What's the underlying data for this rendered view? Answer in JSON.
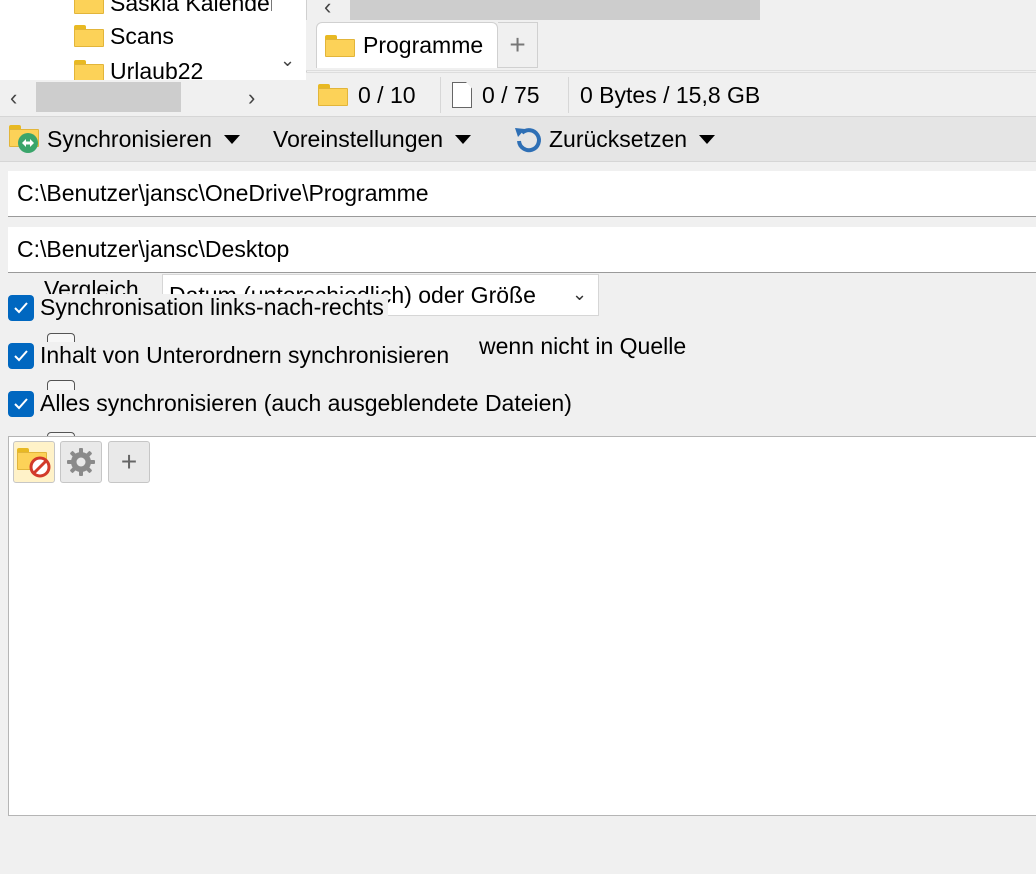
{
  "tree": {
    "items": [
      {
        "label": "Saskia Kalender"
      },
      {
        "label": "Scans"
      },
      {
        "label": "Urlaub22"
      }
    ]
  },
  "tab": {
    "label": "Programme",
    "add_label": "+"
  },
  "status": {
    "folders": "0 / 10",
    "files": "0 / 75",
    "size": "0 Bytes / 15,8 GB"
  },
  "toolbar": {
    "sync_label": "Synchronisieren",
    "presets_label": "Voreinstellungen",
    "reset_label": "Zurücksetzen"
  },
  "paths": {
    "source": "C:\\Benutzer\\jansc\\OneDrive\\Programme",
    "target": "C:\\Benutzer\\jansc\\Desktop"
  },
  "compare": {
    "label": "Vergleich",
    "value": "Datum (unterschiedlich) oder Größe"
  },
  "options": {
    "sync_direction": "Synchronisation links-nach-rechts",
    "subfolders": "Inhalt von Unterordnern synchronisieren",
    "if_not_in_source": "wenn nicht in Quelle",
    "sync_all": "Alles synchronisieren (auch ausgeblendete Dateien)"
  },
  "colors": {
    "checkbox": "#0067c0",
    "folder": "#fcd258",
    "sync_icon": "#3aa56b",
    "reset_icon": "#2e6fb5"
  }
}
